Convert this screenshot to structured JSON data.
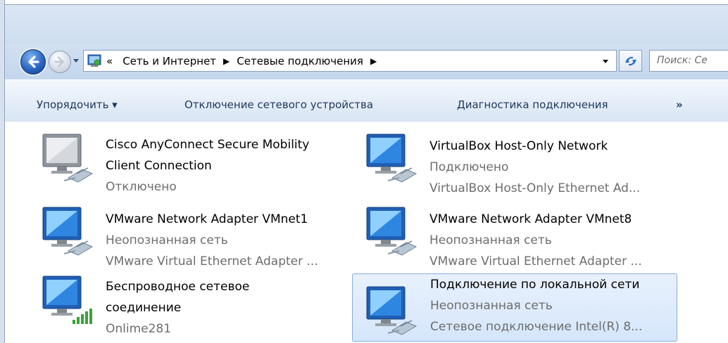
{
  "breadcrumb": {
    "prefix": "«",
    "items": [
      "Сеть и Интернет",
      "Сетевые подключения"
    ],
    "separator": "▶"
  },
  "search": {
    "placeholder": "Поиск: Се"
  },
  "toolbar": {
    "organize": "Упорядочить ▾",
    "disable_device": "Отключение сетевого устройства",
    "diagnose": "Диагностика подключения",
    "more": "»"
  },
  "connections": [
    {
      "name": "Cisco AnyConnect Secure Mobility Client Connection",
      "status": "Отключено",
      "device": "",
      "icon": "network-adapter-disconnected-icon"
    },
    {
      "name": "VirtualBox Host-Only Network",
      "status": "Подключено",
      "device": "VirtualBox Host-Only Ethernet Ad...",
      "icon": "network-adapter-icon"
    },
    {
      "name": "VMware Network Adapter VMnet1",
      "status": "Неопознанная сеть",
      "device": "VMware Virtual Ethernet Adapter ...",
      "icon": "network-adapter-icon"
    },
    {
      "name": "VMware Network Adapter VMnet8",
      "status": "Неопознанная сеть",
      "device": "VMware Virtual Ethernet Adapter ...",
      "icon": "network-adapter-icon"
    },
    {
      "name": "Беспроводное сетевое соединение",
      "status": "Onlime281",
      "device": "",
      "icon": "wireless-adapter-icon"
    },
    {
      "name": "Подключение по локальной сети",
      "status": "Неопознанная сеть",
      "device": "Сетевое подключение Intel(R) 8...",
      "icon": "network-adapter-icon"
    }
  ],
  "colors": {
    "toolbar_text": "#1e395b",
    "selection_fill": "#d5e6fb",
    "selection_border": "#84acdd",
    "secondary_text": "#6d6d6d"
  }
}
